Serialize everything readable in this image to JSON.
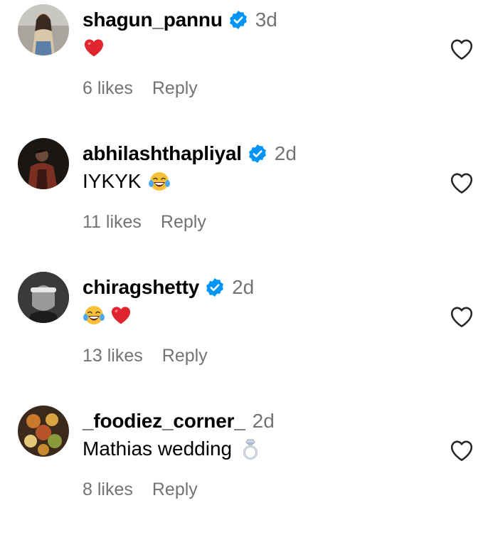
{
  "comments": [
    {
      "username": "shagun_pannu",
      "verified": true,
      "time": "3d",
      "text": "",
      "emojis": [
        "red-heart"
      ],
      "likes": "6 likes",
      "reply_label": "Reply"
    },
    {
      "username": "abhilashthapliyal",
      "verified": true,
      "time": "2d",
      "text": "IYKYK",
      "emojis": [
        "tears-of-joy"
      ],
      "likes": "11 likes",
      "reply_label": "Reply"
    },
    {
      "username": "chiragshetty",
      "verified": true,
      "time": "2d",
      "text": "",
      "emojis": [
        "tears-of-joy",
        "red-heart"
      ],
      "likes": "13 likes",
      "reply_label": "Reply"
    },
    {
      "username": "_foodiez_corner_",
      "verified": false,
      "time": "2d",
      "text": "Mathias wedding",
      "emojis": [
        "ring"
      ],
      "likes": "8 likes",
      "reply_label": "Reply"
    }
  ],
  "colors": {
    "verified_badge": "#0095f6",
    "muted_text": "#737373",
    "heart_emoji": "#e0252f"
  },
  "icons": {
    "like": "heart-outline-icon",
    "verified": "verified-badge-icon"
  }
}
